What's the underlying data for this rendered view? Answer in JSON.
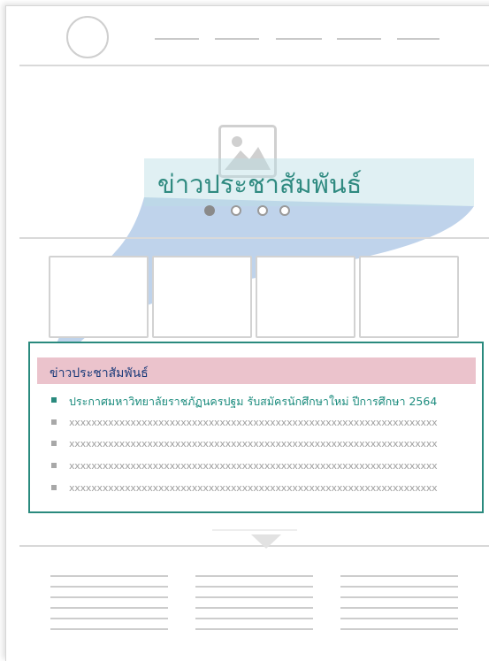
{
  "hero": {
    "title": "ข่าวประชาสัมพันธ์",
    "slide_count": 4,
    "active_slide": 1
  },
  "news": {
    "heading": "ข่าวประชาสัมพันธ์",
    "items": [
      "ประกาศมหาวิทยาลัยราชภัฏนครปฐม รับสมัครนักศึกษาใหม่ ปีการศึกษา 2564",
      "xxxxxxxxxxxxxxxxxxxxxxxxxxxxxxxxxxxxxxxxxxxxxxxxxxxxxxxxxxxxxxxxxx",
      "xxxxxxxxxxxxxxxxxxxxxxxxxxxxxxxxxxxxxxxxxxxxxxxxxxxxxxxxxxxxxxxxxx",
      "xxxxxxxxxxxxxxxxxxxxxxxxxxxxxxxxxxxxxxxxxxxxxxxxxxxxxxxxxxxxxxxxxx",
      "xxxxxxxxxxxxxxxxxxxxxxxxxxxxxxxxxxxxxxxxxxxxxxxxxxxxxxxxxxxxxxxxxx"
    ]
  },
  "colors": {
    "accent_teal": "#2a8a7e",
    "highlight_pink": "#df9eac",
    "callout_blue": "#a9c4e4",
    "banner_mint": "#badee4"
  },
  "icons": {
    "logo": "logo-placeholder-icon",
    "image": "image-placeholder-icon",
    "bullet": "square-bullet-icon"
  }
}
